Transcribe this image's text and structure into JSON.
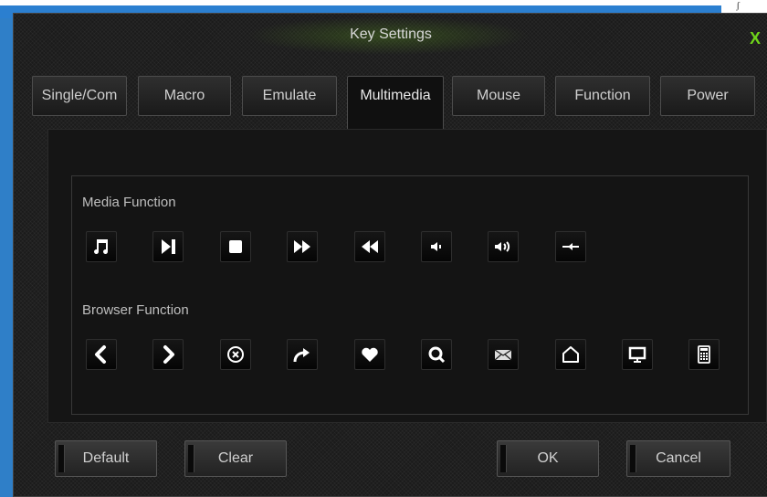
{
  "window": {
    "title": "Key Settings",
    "close_label": "X",
    "corner_glyph": "ʃ"
  },
  "tabs": [
    {
      "label": "Single/Com"
    },
    {
      "label": "Macro"
    },
    {
      "label": "Emulate"
    },
    {
      "label": "Multimedia",
      "active": true
    },
    {
      "label": "Mouse"
    },
    {
      "label": "Function"
    },
    {
      "label": "Power"
    }
  ],
  "media": {
    "label": "Media Function",
    "icons": [
      "music-note-icon",
      "play-next-icon",
      "stop-icon",
      "fast-forward-icon",
      "rewind-icon",
      "volume-down-icon",
      "volume-up-icon",
      "mute-icon"
    ]
  },
  "browser": {
    "label": "Browser Function",
    "icons": [
      "back-arrow-icon",
      "forward-arrow-icon",
      "stop-circle-icon",
      "refresh-arrow-icon",
      "favorites-heart-icon",
      "search-icon",
      "mail-icon",
      "home-icon",
      "my-computer-icon",
      "calculator-icon"
    ]
  },
  "buttons": {
    "default": "Default",
    "clear": "Clear",
    "ok": "OK",
    "cancel": "Cancel"
  },
  "colors": {
    "accent": "#6fd41a",
    "window_bg": "#1b1b1b",
    "desktop": "#2f7fc8"
  }
}
